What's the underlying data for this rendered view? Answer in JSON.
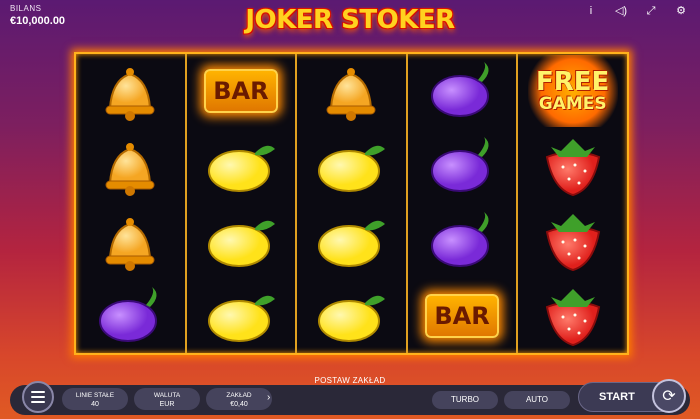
{
  "header": {
    "balance_label": "BILANS",
    "balance_value": "€10,000.00",
    "logo_text": "JOKER STOKER"
  },
  "top_icons": [
    "info-icon",
    "sound-icon",
    "fullscreen-icon",
    "settings-icon"
  ],
  "reels": [
    [
      "bell",
      "bell",
      "bell",
      "plum"
    ],
    [
      "bar",
      "lemon",
      "lemon",
      "lemon"
    ],
    [
      "bell",
      "lemon",
      "lemon",
      "lemon"
    ],
    [
      "plum",
      "plum",
      "plum",
      "bar"
    ],
    [
      "free-games",
      "strawberry",
      "strawberry",
      "strawberry"
    ]
  ],
  "symbols": {
    "bar_text": "BAR",
    "free_line1": "FREE",
    "free_line2": "GAMES"
  },
  "bottom": {
    "bet_title": "POSTAW ZAKŁAD",
    "lines_label": "LINIE STAŁE",
    "lines_value": "40",
    "currency_label": "WALUTA",
    "currency_value": "EUR",
    "bet_label": "ZAKŁAD",
    "bet_value": "€0,40",
    "turbo_label": "TURBO",
    "auto_label": "AUTO",
    "start_label": "START"
  },
  "colors": {
    "frame": "#ffb21c",
    "bell": "#f5a623",
    "plum": "#7a2ad8",
    "lemon": "#ffe21a",
    "strawberry": "#e0201c"
  }
}
